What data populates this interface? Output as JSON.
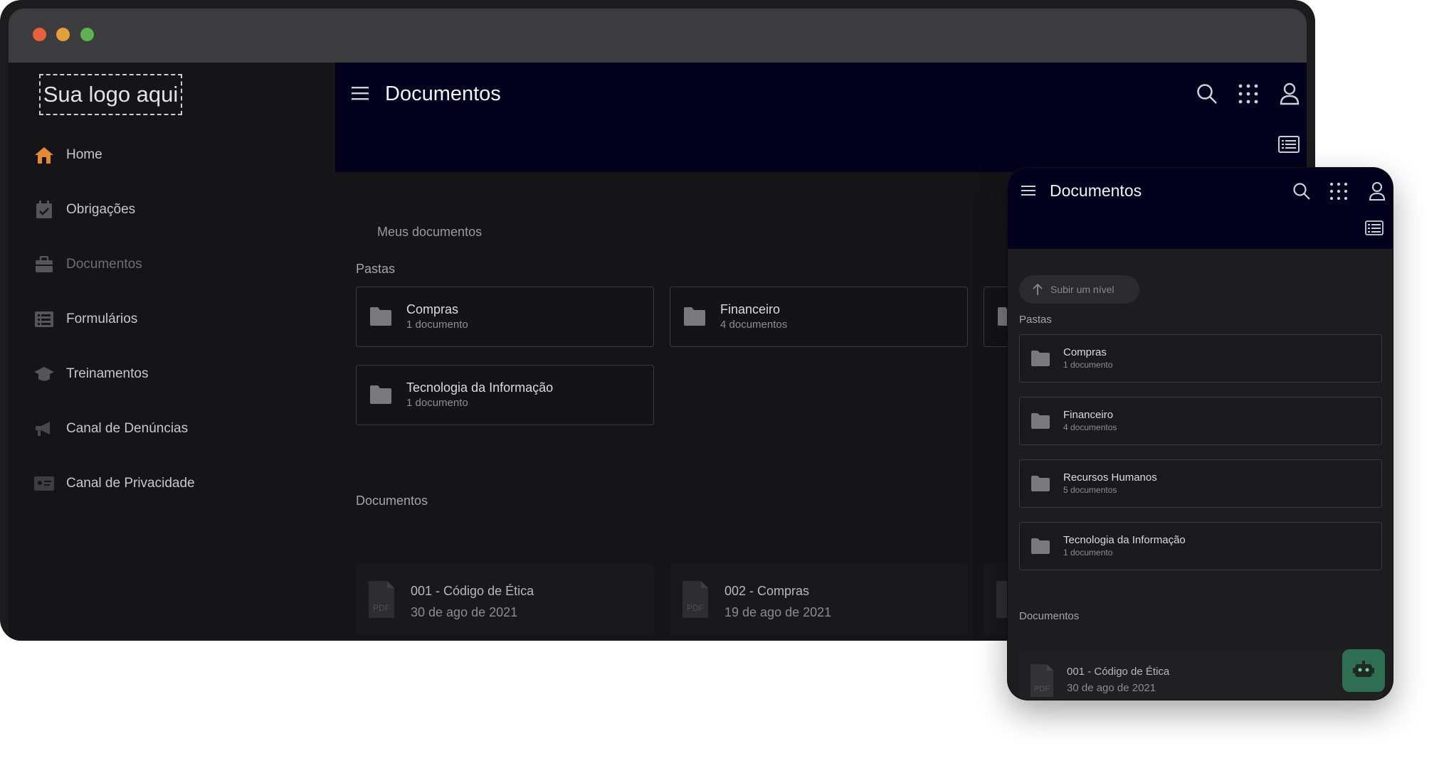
{
  "desktop": {
    "logo_text": "Sua logo aqui",
    "nav": [
      {
        "label": "Home",
        "icon": "home-icon",
        "color": "#e38a3a"
      },
      {
        "label": "Obrigações",
        "icon": "calendar-check-icon"
      },
      {
        "label": "Documentos",
        "icon": "briefcase-icon"
      },
      {
        "label": "Formulários",
        "icon": "form-list-icon"
      },
      {
        "label": "Treinamentos",
        "icon": "graduation-cap-icon"
      },
      {
        "label": "Canal de Denúncias",
        "icon": "megaphone-icon"
      },
      {
        "label": "Canal de Privacidade",
        "icon": "id-card-icon"
      }
    ],
    "header": {
      "title": "Documentos"
    },
    "breadcrumb": "Meus documentos",
    "folders_label": "Pastas",
    "folders": [
      {
        "name": "Compras",
        "count": "1 documento"
      },
      {
        "name": "Financeiro",
        "count": "4 documentos"
      },
      {
        "name": "Tecnologia da Informação",
        "count": "1 documento"
      }
    ],
    "documents_label": "Documentos",
    "documents": [
      {
        "name": "001 - Código de Ética",
        "date": "30 de ago de 2021",
        "icon_text": "PDF"
      },
      {
        "name": "002 - Compras",
        "date": "19 de ago de 2021",
        "icon_text": "PDF"
      }
    ]
  },
  "mobile": {
    "header": {
      "title": "Documentos"
    },
    "up_button": "Subir um nível",
    "folders_label": "Pastas",
    "folders": [
      {
        "name": "Compras",
        "count": "1 documento"
      },
      {
        "name": "Financeiro",
        "count": "4 documentos"
      },
      {
        "name": "Recursos Humanos",
        "count": "5 documentos"
      },
      {
        "name": "Tecnologia da Informação",
        "count": "1 documento"
      }
    ],
    "documents_label": "Documentos",
    "documents": [
      {
        "name": "001 - Código de Ética",
        "date": "30 de ago de 2021",
        "icon_text": "PDF"
      }
    ]
  },
  "colors": {
    "header_bg": "#02021e",
    "app_bg": "#151517",
    "accent_home": "#e38a3a",
    "chat_button": "#2e6e52"
  }
}
